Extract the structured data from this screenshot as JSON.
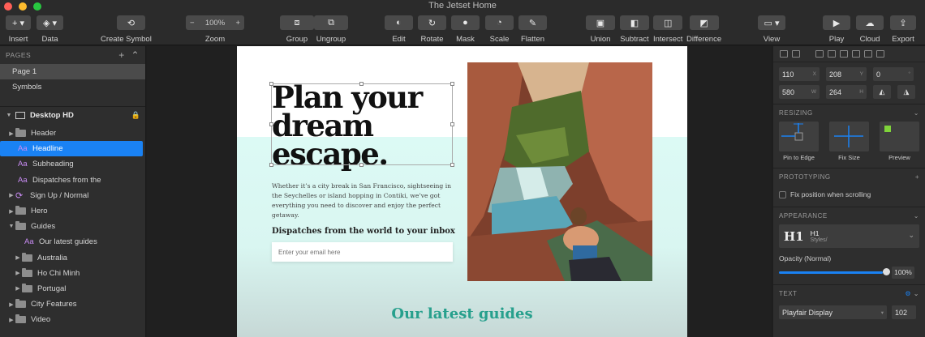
{
  "window": {
    "title": "The Jetset Home"
  },
  "toolbar": {
    "insert": "Insert",
    "data": "Data",
    "create_symbol": "Create Symbol",
    "zoom": "Zoom",
    "zoom_value": "100%",
    "zoom_minus": "−",
    "zoom_plus": "+",
    "group": "Group",
    "ungroup": "Ungroup",
    "edit": "Edit",
    "rotate": "Rotate",
    "mask": "Mask",
    "scale": "Scale",
    "flatten": "Flatten",
    "union": "Union",
    "subtract": "Subtract",
    "intersect": "Intersect",
    "difference": "Difference",
    "view": "View",
    "play": "Play",
    "cloud": "Cloud",
    "export": "Export"
  },
  "layers": {
    "pages_header": "PAGES",
    "pages": [
      "Page 1",
      "Symbols"
    ],
    "artboard": "Desktop HD",
    "items": [
      {
        "label": "Header"
      },
      {
        "label": "Headline"
      },
      {
        "label": "Subheading"
      },
      {
        "label": "Dispatches from the"
      },
      {
        "label": "Sign Up / Normal"
      },
      {
        "label": "Hero"
      },
      {
        "label": "Guides"
      },
      {
        "label": "Our latest guides"
      },
      {
        "label": "Australia"
      },
      {
        "label": "Ho Chi Minh"
      },
      {
        "label": "Portugal"
      },
      {
        "label": "City Features"
      },
      {
        "label": "Video"
      }
    ]
  },
  "canvas": {
    "headline": "Plan your dream escape.",
    "subheading": "Whether it’s a city break in San Francisco, sightseeing in the Seychelles or island hopping in Contiki, we’ve got everything you need to discover and enjoy the perfect getaway.",
    "dispatches": "Dispatches from the world to your inbox",
    "email_placeholder": "Enter your email here",
    "guides_title": "Our latest guides"
  },
  "inspector": {
    "x": "110",
    "x_label": "X",
    "y": "208",
    "y_label": "Y",
    "rotation": "0",
    "rotation_unit": "°",
    "w": "580",
    "w_label": "W",
    "h": "264",
    "h_label": "H",
    "resizing": "RESIZING",
    "pin_to_edge": "Pin to Edge",
    "fix_size": "Fix Size",
    "preview": "Preview",
    "prototyping": "PROTOTYPING",
    "fix_position": "Fix position when scrolling",
    "appearance": "APPEARANCE",
    "style_icon": "H1",
    "style_name": "H1",
    "style_sub": "Styles/",
    "opacity_label": "Opacity (Normal)",
    "opacity": "100%",
    "text": "TEXT",
    "font_family": "Playfair Display",
    "font_size": "102"
  },
  "colors": {
    "selection": "#1a82f4",
    "accent_text": "#27a08d",
    "mint": "#dcfaf5"
  }
}
